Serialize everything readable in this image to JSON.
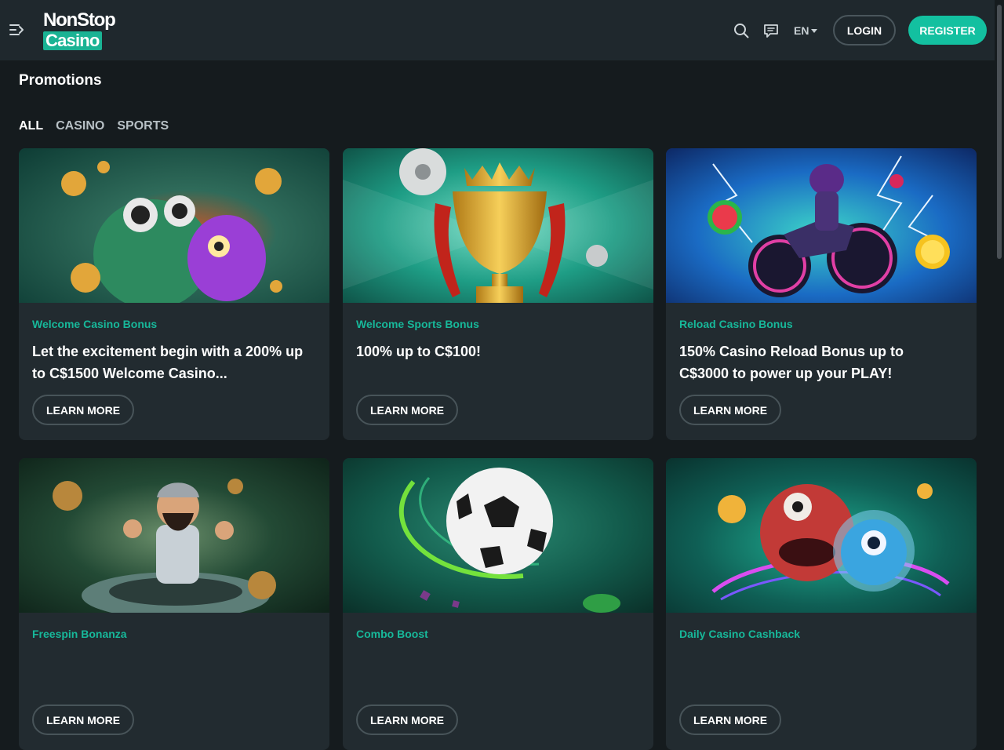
{
  "header": {
    "logo_top": "NonStop",
    "logo_bottom": "Casino",
    "language": "EN",
    "login_label": "LOGIN",
    "register_label": "REGISTER"
  },
  "page": {
    "title": "Promotions",
    "filters": [
      "ALL",
      "CASINO",
      "SPORTS"
    ],
    "active_filter": "ALL"
  },
  "learn_more_label": "LEARN MORE",
  "promotions": [
    {
      "category": "Welcome Casino Bonus",
      "description": "Let the excitement begin with a 200% up to C$1500 Welcome Casino..."
    },
    {
      "category": "Welcome Sports Bonus",
      "description": "100% up to C$100!"
    },
    {
      "category": "Reload Casino Bonus",
      "description": "150% Casino Reload Bonus up to C$3000 to power up your PLAY!"
    },
    {
      "category": "Freespin Bonanza",
      "description": ""
    },
    {
      "category": "Combo Boost",
      "description": ""
    },
    {
      "category": "Daily Casino Cashback",
      "description": ""
    }
  ],
  "colors": {
    "accent": "#13c0a0",
    "category_text": "#17b89a",
    "background": "#151b1e",
    "header": "#1f282d",
    "card": "#222b30"
  }
}
